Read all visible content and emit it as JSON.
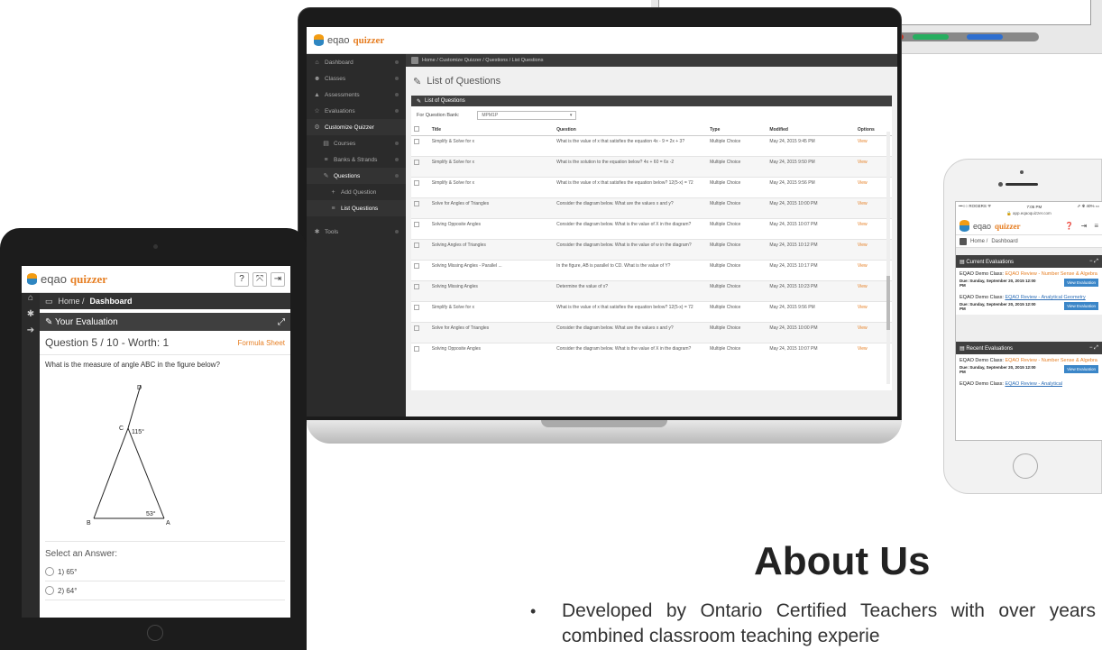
{
  "laptop": {
    "logo_eqao": "eqao",
    "logo_quizzer": "quizzer",
    "sidebar": [
      {
        "icon": "home-icon",
        "glyph": "⌂",
        "label": "Dashboard",
        "level": 0
      },
      {
        "icon": "users-icon",
        "glyph": "☻",
        "label": "Classes",
        "level": 0
      },
      {
        "icon": "sitemap-icon",
        "glyph": "▲",
        "label": "Assessments",
        "level": 0
      },
      {
        "icon": "star-icon",
        "glyph": "☆",
        "label": "Evaluations",
        "level": 0
      },
      {
        "icon": "gears-icon",
        "glyph": "⚙",
        "label": "Customize Quizzer",
        "level": 0,
        "active": true
      },
      {
        "icon": "book-icon",
        "glyph": "▤",
        "label": "Courses",
        "level": 1
      },
      {
        "icon": "list-icon",
        "glyph": "≡",
        "label": "Banks & Strands",
        "level": 1
      },
      {
        "icon": "edit-icon",
        "glyph": "✎",
        "label": "Questions",
        "level": 1,
        "active": true
      },
      {
        "icon": "plus-icon",
        "glyph": "+",
        "label": "Add Question",
        "level": 2
      },
      {
        "icon": "list-icon",
        "glyph": "≡",
        "label": "List Questions",
        "level": 2,
        "active": true
      },
      {
        "icon": "wrench-icon",
        "glyph": "✱",
        "label": "Tools",
        "level": 0
      }
    ],
    "breadcrumb": "Home / Customize Quizzer / Questions / List Questions",
    "page_title": "List of Questions",
    "panel_title": "List of Questions",
    "filter_label": "For Question Bank:",
    "filter_value": "MPM1P",
    "columns": [
      "Title",
      "Question",
      "Type",
      "Modified",
      "Options"
    ],
    "rows": [
      [
        "Simplify & Solve for x",
        "What is the value of x that satisfies the equation 4x - 9 = 2x + 3?",
        "Multiple Choice",
        "May 24, 2015 9:45 PM",
        "View"
      ],
      [
        "Simplify & Solve for x",
        "What is the solution to the equation below? 4x + 60 = 6x -2",
        "Multiple Choice",
        "May 24, 2015 9:50 PM",
        "View"
      ],
      [
        "Simplify & Solve for x",
        "What is the value of x that satisfies the equation below? 12(5-x) = 72",
        "Multiple Choice",
        "May 24, 2015 9:56 PM",
        "View"
      ],
      [
        "Solve for Angles of Triangles",
        "Consider the diagram below. What are the values x and y?",
        "Multiple Choice",
        "May 24, 2015 10:00 PM",
        "View"
      ],
      [
        "Solving Opposite Angles",
        "Consider the diagram below. What is the value of X in the diagram?",
        "Multiple Choice",
        "May 24, 2015 10:07 PM",
        "View"
      ],
      [
        "Solving Angles of Triangles",
        "Consider the diagram below. What is the value of w in the diagram?",
        "Multiple Choice",
        "May 24, 2015 10:12 PM",
        "View"
      ],
      [
        "Solving Missing Angles - Parallel ...",
        "In the figure, AB is parallel to CD. What is the value of Y?",
        "Multiple Choice",
        "May 24, 2015 10:17 PM",
        "View"
      ],
      [
        "Solving Missing Angles",
        "Determine the value of x?",
        "Multiple Choice",
        "May 24, 2015 10:23 PM",
        "View"
      ],
      [
        "Simplify & Solve for x",
        "What is the value of x that satisfies the equation below? 12(5-x) = 72",
        "Multiple Choice",
        "May 24, 2015 9:56 PM",
        "View"
      ],
      [
        "Solve for Angles of Triangles",
        "Consider the diagram below. What are the values x and y?",
        "Multiple Choice",
        "May 24, 2015 10:00 PM",
        "View"
      ],
      [
        "Solving Opposite Angles",
        "Consider the diagram below. What is the value of X in the diagram?",
        "Multiple Choice",
        "May 24, 2015 10:07 PM",
        "View"
      ]
    ]
  },
  "tablet": {
    "logo_eqao": "eqao",
    "logo_quizzer": "quizzer",
    "crumb_home": "Home /",
    "crumb_page": "Dashboard",
    "panel_title": "Your Evaluation",
    "question_line": "Question 5 / 10 - Worth: 1",
    "formula_sheet": "Formula Sheet",
    "question_text": "What is the measure of angle ABC in the figure below?",
    "diagram_labels": {
      "d": "D",
      "c": "C",
      "b": "B",
      "a": "A",
      "angle_c": "115°",
      "angle_a": "53°"
    },
    "answer_label": "Select an Answer:",
    "answers": [
      "1) 65°",
      "2) 64°"
    ]
  },
  "phone": {
    "carrier": "•••○○ ROGERS ᯤ",
    "time": "7:05 PM",
    "battery": "⇗ ✻ 40% ▭",
    "url": "🔒 app.eqaoquizzer.com",
    "logo_eqao": "eqao",
    "logo_quizzer": "quizzer",
    "crumb_home": "Home /",
    "crumb_page": "Dashboard",
    "current_title": "Current Evaluations",
    "recent_title": "Recent Evaluations",
    "current": [
      {
        "cls": "EQAO Demo Class:",
        "link": "EQAO Review - Number Sense & Algebra",
        "due": "Due: Sunday, September 20, 2015 12:00 PM",
        "btn": "View Evaluation"
      },
      {
        "cls": "EQAO Demo Class:",
        "link": "EQAO Review - Analytical Geometry",
        "due": "Due: Sunday, September 20, 2015 12:00 PM",
        "btn": "View Evaluation"
      }
    ],
    "recent": [
      {
        "cls": "EQAO Demo Class:",
        "link": "EQAO Review - Number Sense & Algebra",
        "due": "Due: Sunday, September 20, 2015 12:00 PM",
        "btn": "View Evaluation"
      },
      {
        "cls": "EQAO Demo Class:",
        "link": "EQAO Review - Analytical",
        "due": "",
        "btn": ""
      }
    ]
  },
  "about": {
    "title": "About Us",
    "bullet": "Developed by Ontario Certified Teachers with over years of combined classroom teaching experie"
  }
}
